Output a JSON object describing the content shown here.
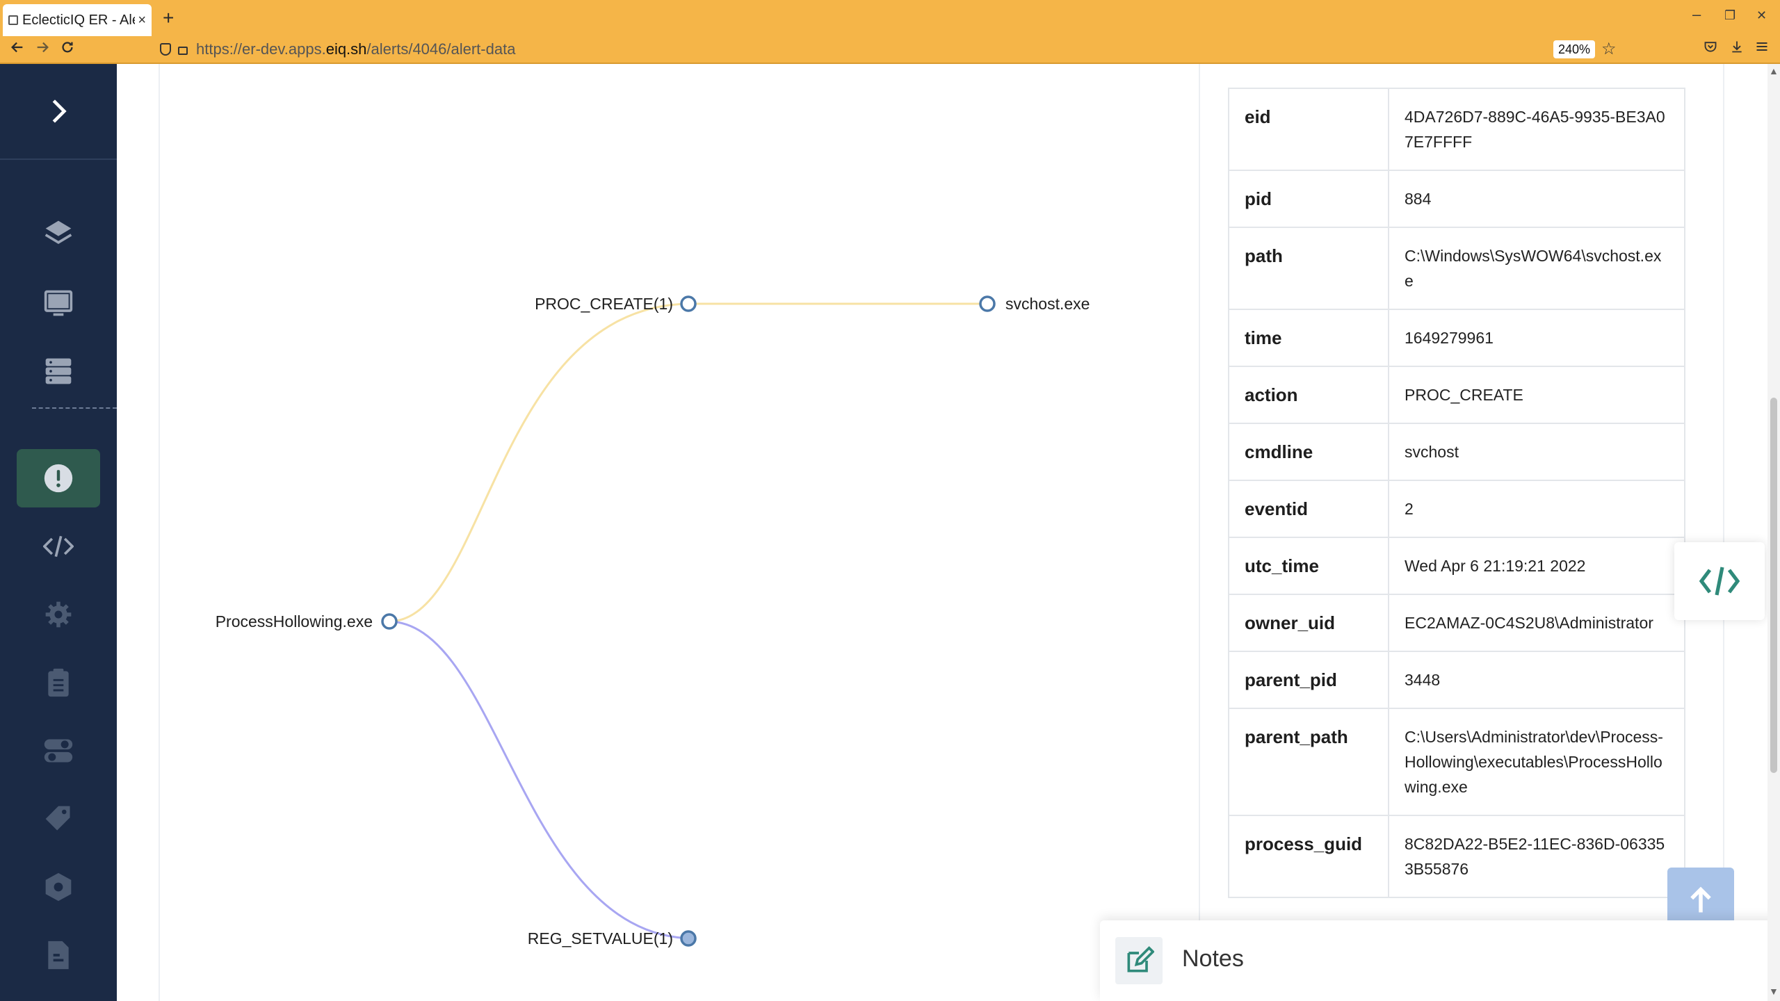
{
  "browser": {
    "tab_title": "EclecticIQ ER - Alert",
    "tab_close": "×",
    "new_tab": "+",
    "url_prefix": "https://er-dev.apps.",
    "url_domain": "eiq.sh",
    "url_path": "/alerts/4046/alert-data",
    "zoom": "240%",
    "minimize": "–",
    "restore": "❐",
    "close": "✕"
  },
  "sidebar": {
    "items": [
      {
        "name": "layers",
        "icon": "layers-icon"
      },
      {
        "name": "monitor",
        "icon": "monitor-icon"
      },
      {
        "name": "server",
        "icon": "server-icon"
      },
      {
        "name": "alerts",
        "icon": "alert-icon",
        "active": true
      },
      {
        "name": "code",
        "icon": "code-icon"
      },
      {
        "name": "settings",
        "icon": "gear-icon"
      },
      {
        "name": "clipboard",
        "icon": "clipboard-icon"
      },
      {
        "name": "toggles",
        "icon": "toggle-icon"
      },
      {
        "name": "tags",
        "icon": "tag-icon"
      },
      {
        "name": "hexagon",
        "icon": "hexagon-icon"
      },
      {
        "name": "document",
        "icon": "document-icon"
      }
    ],
    "colors": {
      "bg": "#1b2a45",
      "active": "#2f5a4e",
      "icon": "#9aa4b5"
    }
  },
  "graph": {
    "nodes": {
      "root": "ProcessHollowing.exe",
      "proc_create": "PROC_CREATE(1)",
      "svchost": "svchost.exe",
      "reg_setvalue": "REG_SETVALUE(1)"
    },
    "colors": {
      "proc_edge": "#f7e2a4",
      "reg_edge": "#a8a6f2",
      "node_stroke": "#4b78a8",
      "filled_node": "#9bb6dc"
    }
  },
  "details": {
    "rows": [
      {
        "key": "eid",
        "value": "4DA726D7-889C-46A5-9935-BE3A07E7FFFF"
      },
      {
        "key": "pid",
        "value": "884"
      },
      {
        "key": "path",
        "value": "C:\\Windows\\SysWOW64\\svchost.exe"
      },
      {
        "key": "time",
        "value": "1649279961"
      },
      {
        "key": "action",
        "value": "PROC_CREATE"
      },
      {
        "key": "cmdline",
        "value": "svchost"
      },
      {
        "key": "eventid",
        "value": "2"
      },
      {
        "key": "utc_time",
        "value": "Wed Apr 6 21:19:21 2022"
      },
      {
        "key": "owner_uid",
        "value": "EC2AMAZ-0C4S2U8\\Administrator"
      },
      {
        "key": "parent_pid",
        "value": "3448"
      },
      {
        "key": "parent_path",
        "value": "C:\\Users\\Administrator\\dev\\Process-Hollowing\\executables\\ProcessHollowing.exe"
      },
      {
        "key": "process_guid",
        "value": "8C82DA22-B5E2-11EC-836D-063353B55876"
      }
    ]
  },
  "notes": {
    "label": "Notes"
  }
}
